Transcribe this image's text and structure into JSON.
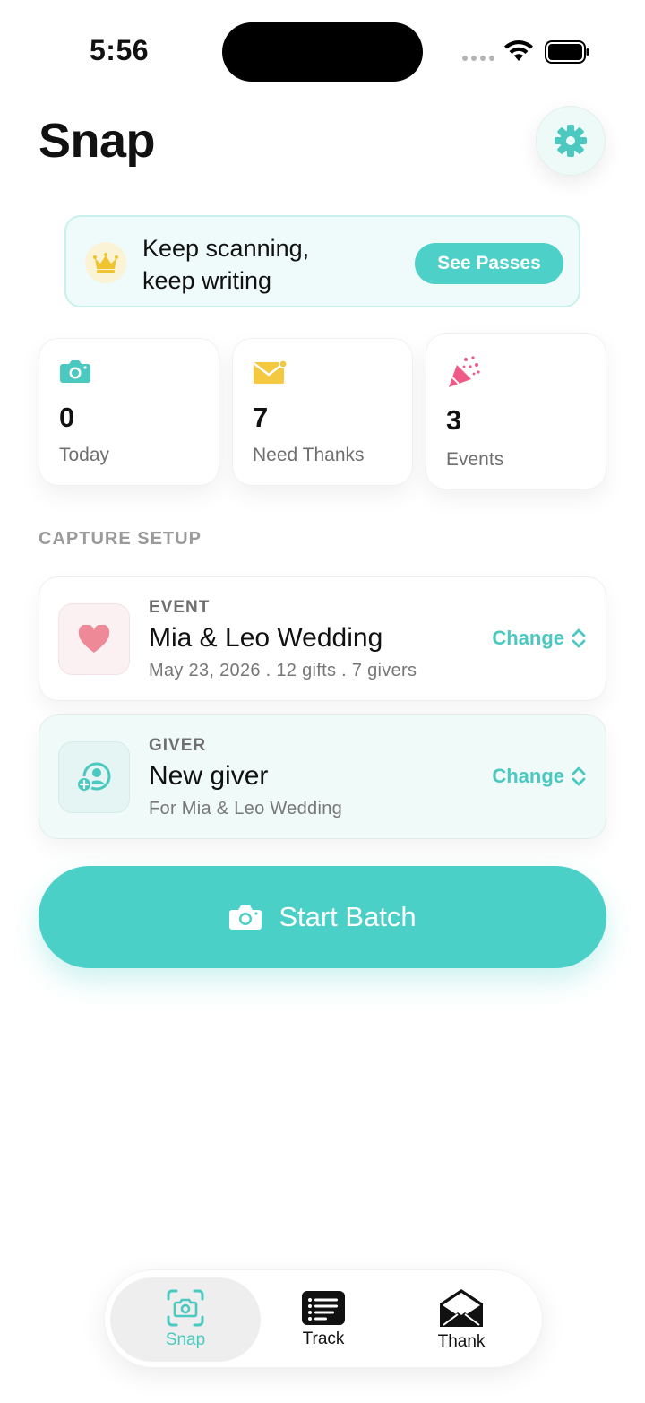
{
  "status_bar": {
    "time": "5:56"
  },
  "header": {
    "title": "Snap",
    "settings_icon": "gear-icon"
  },
  "promo": {
    "line1": "Keep scanning,",
    "line2": "keep writing",
    "button_label": "See Passes",
    "icon": "crown-icon"
  },
  "stats": [
    {
      "icon": "camera-icon",
      "value": "0",
      "label": "Today"
    },
    {
      "icon": "envelope-icon",
      "value": "7",
      "label": "Need Thanks"
    },
    {
      "icon": "party-popper-icon",
      "value": "3",
      "label": "Events"
    }
  ],
  "section_label": "CAPTURE SETUP",
  "event_card": {
    "kicker": "EVENT",
    "title": "Mia & Leo Wedding",
    "subtitle": "May 23, 2026 . 12 gifts . 7 givers",
    "change_label": "Change"
  },
  "giver_card": {
    "kicker": "GIVER",
    "title": "New giver",
    "subtitle": "For Mia & Leo Wedding",
    "change_label": "Change"
  },
  "start_button": {
    "label": "Start Batch"
  },
  "tabs": [
    {
      "label": "Snap",
      "active": true
    },
    {
      "label": "Track",
      "active": false
    },
    {
      "label": "Thank",
      "active": false
    }
  ],
  "colors": {
    "accent": "#4bd0c8",
    "heart": "#ee8a98",
    "envelope": "#f5c842",
    "crown": "#f0c431"
  }
}
